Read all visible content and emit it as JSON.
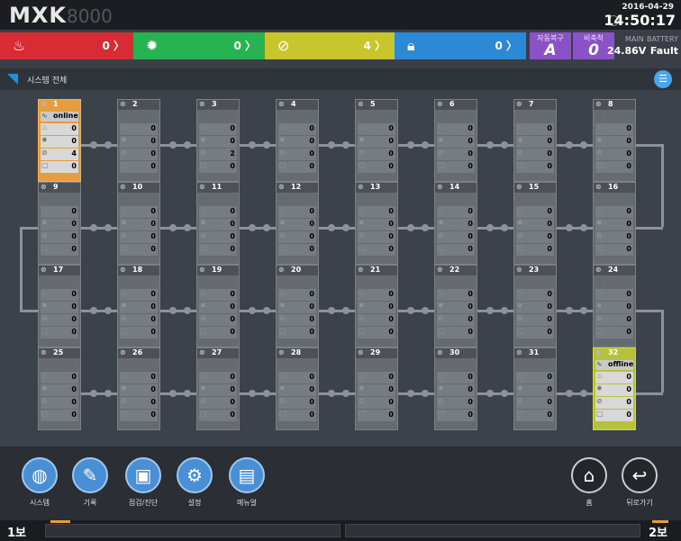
{
  "header": {
    "logo_main": "MXK",
    "logo_sub": "8000",
    "date": "2016-04-29",
    "time": "14:50:17"
  },
  "status": {
    "fire": {
      "icon": "fire-icon",
      "count": "0 〉"
    },
    "fault": {
      "icon": "gear-fault-icon",
      "count": "0 〉"
    },
    "disable": {
      "icon": "disable-icon",
      "count": "4 〉"
    },
    "lock": {
      "icon": "lock-icon",
      "count": "0 〉"
    },
    "auto_restore": {
      "label": "자동복구",
      "value": "A"
    },
    "non_stop": {
      "label": "비축척",
      "value": "0"
    },
    "power": {
      "main_label": "MAIN",
      "battery_label": "BATTERY",
      "main_value": "24.86V",
      "battery_value": "Fault"
    }
  },
  "subheader": {
    "title": "시스템 전체"
  },
  "units": [
    {
      "n": "1",
      "state": "online",
      "status_text": "online",
      "values": [
        "0",
        "0",
        "4",
        "0"
      ]
    },
    {
      "n": "2",
      "state": "dim",
      "status_text": "",
      "values": [
        "0",
        "0",
        "0",
        "0"
      ]
    },
    {
      "n": "3",
      "state": "dim",
      "status_text": "",
      "values": [
        "0",
        "0",
        "2",
        "0"
      ]
    },
    {
      "n": "4",
      "state": "dim",
      "status_text": "",
      "values": [
        "0",
        "0",
        "0",
        "0"
      ]
    },
    {
      "n": "5",
      "state": "dim",
      "status_text": "",
      "values": [
        "0",
        "0",
        "0",
        "0"
      ]
    },
    {
      "n": "6",
      "state": "dim",
      "status_text": "",
      "values": [
        "0",
        "0",
        "0",
        "0"
      ]
    },
    {
      "n": "7",
      "state": "dim",
      "status_text": "",
      "values": [
        "0",
        "0",
        "0",
        "0"
      ]
    },
    {
      "n": "8",
      "state": "dim",
      "status_text": "",
      "values": [
        "0",
        "0",
        "0",
        "0"
      ]
    },
    {
      "n": "9",
      "state": "dim",
      "status_text": "",
      "values": [
        "0",
        "0",
        "0",
        "0"
      ]
    },
    {
      "n": "10",
      "state": "dim",
      "status_text": "",
      "values": [
        "0",
        "0",
        "0",
        "0"
      ]
    },
    {
      "n": "11",
      "state": "dim",
      "status_text": "",
      "values": [
        "0",
        "0",
        "0",
        "0"
      ]
    },
    {
      "n": "12",
      "state": "dim",
      "status_text": "",
      "values": [
        "0",
        "0",
        "0",
        "0"
      ]
    },
    {
      "n": "13",
      "state": "dim",
      "status_text": "",
      "values": [
        "0",
        "0",
        "0",
        "0"
      ]
    },
    {
      "n": "14",
      "state": "dim",
      "status_text": "",
      "values": [
        "0",
        "0",
        "0",
        "0"
      ]
    },
    {
      "n": "15",
      "state": "dim",
      "status_text": "",
      "values": [
        "0",
        "0",
        "0",
        "0"
      ]
    },
    {
      "n": "16",
      "state": "dim",
      "status_text": "",
      "values": [
        "0",
        "0",
        "0",
        "0"
      ]
    },
    {
      "n": "17",
      "state": "dim",
      "status_text": "",
      "values": [
        "0",
        "0",
        "0",
        "0"
      ]
    },
    {
      "n": "18",
      "state": "dim",
      "status_text": "",
      "values": [
        "0",
        "0",
        "0",
        "0"
      ]
    },
    {
      "n": "19",
      "state": "dim",
      "status_text": "",
      "values": [
        "0",
        "0",
        "0",
        "0"
      ]
    },
    {
      "n": "20",
      "state": "dim",
      "status_text": "",
      "values": [
        "0",
        "0",
        "0",
        "0"
      ]
    },
    {
      "n": "21",
      "state": "dim",
      "status_text": "",
      "values": [
        "0",
        "0",
        "0",
        "0"
      ]
    },
    {
      "n": "22",
      "state": "dim",
      "status_text": "",
      "values": [
        "0",
        "0",
        "0",
        "0"
      ]
    },
    {
      "n": "23",
      "state": "dim",
      "status_text": "",
      "values": [
        "0",
        "0",
        "0",
        "0"
      ]
    },
    {
      "n": "24",
      "state": "dim",
      "status_text": "",
      "values": [
        "0",
        "0",
        "0",
        "0"
      ]
    },
    {
      "n": "25",
      "state": "dim",
      "status_text": "",
      "values": [
        "0",
        "0",
        "0",
        "0"
      ]
    },
    {
      "n": "26",
      "state": "dim",
      "status_text": "",
      "values": [
        "0",
        "0",
        "0",
        "0"
      ]
    },
    {
      "n": "27",
      "state": "dim",
      "status_text": "",
      "values": [
        "0",
        "0",
        "0",
        "0"
      ]
    },
    {
      "n": "28",
      "state": "dim",
      "status_text": "",
      "values": [
        "0",
        "0",
        "0",
        "0"
      ]
    },
    {
      "n": "29",
      "state": "dim",
      "status_text": "",
      "values": [
        "0",
        "0",
        "0",
        "0"
      ]
    },
    {
      "n": "30",
      "state": "dim",
      "status_text": "",
      "values": [
        "0",
        "0",
        "0",
        "0"
      ]
    },
    {
      "n": "31",
      "state": "dim",
      "status_text": "",
      "values": [
        "0",
        "0",
        "0",
        "0"
      ]
    },
    {
      "n": "32",
      "state": "offline",
      "status_text": "offline",
      "values": [
        "0",
        "0",
        "0",
        "0"
      ]
    }
  ],
  "toolbar": {
    "system": "시스템",
    "record": "기록",
    "inspect": "점검/진단",
    "settings": "설정",
    "manual": "메뉴얼",
    "home": "홈",
    "back": "뒤로가기"
  },
  "footer": {
    "left_floor": "1보",
    "right_floor": "2보"
  },
  "colors": {
    "fire": "#d92b34",
    "fault": "#27b351",
    "disable": "#c8c62c",
    "lock": "#2b89d6",
    "mode": "#8b52c7",
    "online": "#e79c3e",
    "offline": "#b6c23a"
  }
}
